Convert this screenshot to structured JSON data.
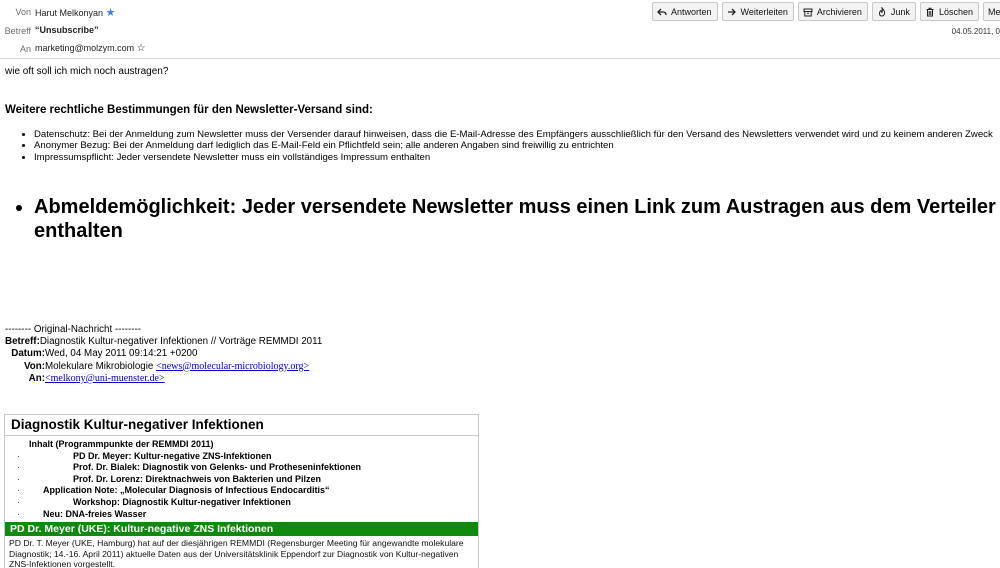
{
  "header": {
    "from_label": "Von",
    "from_value": "Harut Melkonyan",
    "subject_label": "Betreff",
    "subject_value": "“Unsubscribe”",
    "to_label": "An",
    "to_value": "marketing@molzym.com",
    "date": "04.05.2011, 0"
  },
  "toolbar": {
    "reply": "Antworten",
    "forward": "Weiterleiten",
    "archive": "Archivieren",
    "junk": "Junk",
    "delete": "Löschen",
    "more": "Meh"
  },
  "message": {
    "line1": "wie oft soll ich mich noch austragen?",
    "legal_heading": "Weitere rechtliche Bestimmungen für den Newsletter-Versand sind:",
    "bullets": [
      "Datenschutz: Bei der Anmeldung zum Newsletter muss der Versender darauf hinweisen, dass die E-Mail-Adresse des Empfängers ausschließlich für den Versand des Newsletters verwendet wird und zu keinem anderen Zweck",
      "Anonymer Bezug: Bei der Anmeldung darf lediglich das E-Mail-Feld ein Pflichtfeld sein; alle anderen Angaben sind freiwillig zu entrichten",
      "Impressumspflicht: Jeder versendete Newsletter muss ein vollständiges Impressum enthalten"
    ],
    "big_bullet": "Abmeldemöglichkeit: Jeder versendete Newsletter muss einen Link zum Austragen aus dem Verteiler enthalten"
  },
  "original": {
    "separator": "-------- Original-Nachricht --------",
    "subject_label": "Betreff:",
    "subject_value": "Diagnostik Kultur-negativer Infektionen // Vorträge REMMDI 2011",
    "date_label": "Datum:",
    "date_value": "Wed, 04 May 2011 09:14:21 +0200",
    "from_label": "Von:",
    "from_value": "Molekulare Mikrobiologie ",
    "from_link": "<news@molecular-microbiology.org>",
    "to_label": "An:",
    "to_link": "<melkony@uni-muenster.de>"
  },
  "newsletter": {
    "title": "Diagnostik Kultur-negativer Infektionen",
    "toc": [
      "Inhalt (Programmpunkte der REMMDI 2011)",
      "PD Dr. Meyer: Kultur-negative ZNS-Infektionen",
      "Prof. Dr. Bialek: Diagnostik von Gelenks- und Protheseninfektionen",
      "Prof. Dr. Lorenz: Direktnachweis von Bakterien und Pilzen",
      "Application Note: „Molecular Diagnosis of Infectious Endocarditis“",
      "Workshop: Diagnostik Kultur-negativer Infektionen",
      "Neu: DNA-freies Wasser"
    ],
    "section_title": "PD Dr. Meyer (UKE): Kultur-negative ZNS Infektionen",
    "section_text": "PD Dr. T. Meyer (UKE, Hamburg) hat auf der diesjährigen REMMDI (Regensburger Meeting für angewandte molekulare Diagnostik; 14.-16. April 2011) aktuelle Daten aus der Universitätsklinik Eppendorf zur Diagnostik von Kultur-negativen ZNS-Infektionen vorgestellt."
  },
  "colors": {
    "green_bar": "#0f8a0f",
    "link": "#0000cc",
    "star": "#3b82d6"
  }
}
